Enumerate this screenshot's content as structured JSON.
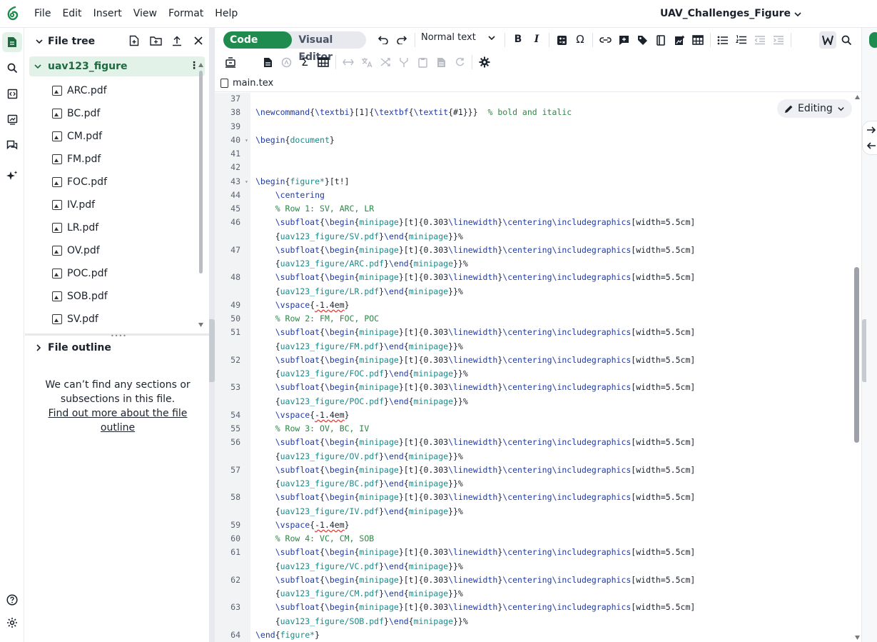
{
  "menu": {
    "items": [
      "File",
      "Edit",
      "Insert",
      "View",
      "Format",
      "Help"
    ],
    "doc_title": "UAV_Challenges_Figure"
  },
  "file_tree": {
    "title": "File tree",
    "folder": "uav123_figure",
    "files": [
      "ARC.pdf",
      "BC.pdf",
      "CM.pdf",
      "FM.pdf",
      "FOC.pdf",
      "IV.pdf",
      "LR.pdf",
      "OV.pdf",
      "POC.pdf",
      "SOB.pdf",
      "SV.pdf"
    ]
  },
  "outline": {
    "title": "File outline",
    "message": "We can’t find any sections or subsections in this file.",
    "link": "Find out more about the file outline"
  },
  "toolbar": {
    "code_editor": "Code Editor",
    "visual_editor": "Visual Editor",
    "text_style": "Normal text",
    "sum_symbol": "Σ",
    "omega_symbol": "Ω"
  },
  "tab": {
    "filename": "main.tex"
  },
  "editor": {
    "mode_badge": "Editing",
    "lines": [
      {
        "n": "37",
        "html": ""
      },
      {
        "n": "38",
        "html": "<span class='kw'>\\newcommand</span>{<span class='kw'>\\textbi</span>}[1]{<span class='kw'>\\textbf</span>{<span class='kw'>\\textit</span>{#1}}}  <span class='cm'>% bold and italic</span>"
      },
      {
        "n": "39",
        "html": ""
      },
      {
        "n": "40",
        "html": "<span class='kw'>\\begin</span>{<span class='ar'>document</span>}",
        "fold": true
      },
      {
        "n": "41",
        "html": ""
      },
      {
        "n": "42",
        "html": ""
      },
      {
        "n": "43",
        "html": "<span class='kw'>\\begin</span>{<span class='ar'>figure*</span>}[t!]",
        "fold": true
      },
      {
        "n": "44",
        "html": "    <span class='kw'>\\centering</span>"
      },
      {
        "n": "45",
        "html": "    <span class='cm'>% Row 1: SV, ARC, LR</span>"
      },
      {
        "n": "46",
        "html": "    <span class='kw'>\\subfloat</span>{<span class='kw'>\\begin</span>{<span class='ar'>minipage</span>}[t]{0.303<span class='kw'>\\linewidth</span>}<span class='kw'>\\centering</span><span class='kw'>\\includegraphics</span>[width=5.5cm]",
        "cont": "    {<span class='ar'>uav123_figure/SV.pdf</span>}<span class='kw'>\\end</span>{<span class='ar'>minipage</span>}}%"
      },
      {
        "n": "47",
        "html": "    <span class='kw'>\\subfloat</span>{<span class='kw'>\\begin</span>{<span class='ar'>minipage</span>}[t]{0.303<span class='kw'>\\linewidth</span>}<span class='kw'>\\centering</span><span class='kw'>\\includegraphics</span>[width=5.5cm]",
        "cont": "    {<span class='ar'>uav123_figure/ARC.pdf</span>}<span class='kw'>\\end</span>{<span class='ar'>minipage</span>}}%"
      },
      {
        "n": "48",
        "html": "    <span class='kw'>\\subfloat</span>{<span class='kw'>\\begin</span>{<span class='ar'>minipage</span>}[t]{0.303<span class='kw'>\\linewidth</span>}<span class='kw'>\\centering</span><span class='kw'>\\includegraphics</span>[width=5.5cm]",
        "cont": "    {<span class='ar'>uav123_figure/LR.pdf</span>}<span class='kw'>\\end</span>{<span class='ar'>minipage</span>}}%"
      },
      {
        "n": "49",
        "html": "    <span class='kw'>\\vspace</span>{<span class='sq'>-1.4em</span>}"
      },
      {
        "n": "50",
        "html": "    <span class='cm'>% Row 2: FM, FOC, POC</span>"
      },
      {
        "n": "51",
        "html": "    <span class='kw'>\\subfloat</span>{<span class='kw'>\\begin</span>{<span class='ar'>minipage</span>}[t]{0.303<span class='kw'>\\linewidth</span>}<span class='kw'>\\centering</span><span class='kw'>\\includegraphics</span>[width=5.5cm]",
        "cont": "    {<span class='ar'>uav123_figure/FM.pdf</span>}<span class='kw'>\\end</span>{<span class='ar'>minipage</span>}}%"
      },
      {
        "n": "52",
        "html": "    <span class='kw'>\\subfloat</span>{<span class='kw'>\\begin</span>{<span class='ar'>minipage</span>}[t]{0.303<span class='kw'>\\linewidth</span>}<span class='kw'>\\centering</span><span class='kw'>\\includegraphics</span>[width=5.5cm]",
        "cont": "    {<span class='ar'>uav123_figure/FOC.pdf</span>}<span class='kw'>\\end</span>{<span class='ar'>minipage</span>}}%"
      },
      {
        "n": "53",
        "html": "    <span class='kw'>\\subfloat</span>{<span class='kw'>\\begin</span>{<span class='ar'>minipage</span>}[t]{0.303<span class='kw'>\\linewidth</span>}<span class='kw'>\\centering</span><span class='kw'>\\includegraphics</span>[width=5.5cm]",
        "cont": "    {<span class='ar'>uav123_figure/POC.pdf</span>}<span class='kw'>\\end</span>{<span class='ar'>minipage</span>}}%"
      },
      {
        "n": "54",
        "html": "    <span class='kw'>\\vspace</span>{<span class='sq'>-1.4em</span>}"
      },
      {
        "n": "55",
        "html": "    <span class='cm'>% Row 3: OV, BC, IV</span>"
      },
      {
        "n": "56",
        "html": "    <span class='kw'>\\subfloat</span>{<span class='kw'>\\begin</span>{<span class='ar'>minipage</span>}[t]{0.303<span class='kw'>\\linewidth</span>}<span class='kw'>\\centering</span><span class='kw'>\\includegraphics</span>[width=5.5cm]",
        "cont": "    {<span class='ar'>uav123_figure/OV.pdf</span>}<span class='kw'>\\end</span>{<span class='ar'>minipage</span>}}%"
      },
      {
        "n": "57",
        "html": "    <span class='kw'>\\subfloat</span>{<span class='kw'>\\begin</span>{<span class='ar'>minipage</span>}[t]{0.303<span class='kw'>\\linewidth</span>}<span class='kw'>\\centering</span><span class='kw'>\\includegraphics</span>[width=5.5cm]",
        "cont": "    {<span class='ar'>uav123_figure/BC.pdf</span>}<span class='kw'>\\end</span>{<span class='ar'>minipage</span>}}%"
      },
      {
        "n": "58",
        "html": "    <span class='kw'>\\subfloat</span>{<span class='kw'>\\begin</span>{<span class='ar'>minipage</span>}[t]{0.303<span class='kw'>\\linewidth</span>}<span class='kw'>\\centering</span><span class='kw'>\\includegraphics</span>[width=5.5cm]",
        "cont": "    {<span class='ar'>uav123_figure/IV.pdf</span>}<span class='kw'>\\end</span>{<span class='ar'>minipage</span>}}%"
      },
      {
        "n": "59",
        "html": "    <span class='kw'>\\vspace</span>{<span class='sq'>-1.4em</span>}"
      },
      {
        "n": "60",
        "html": "    <span class='cm'>% Row 4: VC, CM, SOB</span>"
      },
      {
        "n": "61",
        "html": "    <span class='kw'>\\subfloat</span>{<span class='kw'>\\begin</span>{<span class='ar'>minipage</span>}[t]{0.303<span class='kw'>\\linewidth</span>}<span class='kw'>\\centering</span><span class='kw'>\\includegraphics</span>[width=5.5cm]",
        "cont": "    {<span class='ar'>uav123_figure/VC.pdf</span>}<span class='kw'>\\end</span>{<span class='ar'>minipage</span>}}%"
      },
      {
        "n": "62",
        "html": "    <span class='kw'>\\subfloat</span>{<span class='kw'>\\begin</span>{<span class='ar'>minipage</span>}[t]{0.303<span class='kw'>\\linewidth</span>}<span class='kw'>\\centering</span><span class='kw'>\\includegraphics</span>[width=5.5cm]",
        "cont": "    {<span class='ar'>uav123_figure/CM.pdf</span>}<span class='kw'>\\end</span>{<span class='ar'>minipage</span>}}%"
      },
      {
        "n": "63",
        "html": "    <span class='kw'>\\subfloat</span>{<span class='kw'>\\begin</span>{<span class='ar'>minipage</span>}[t]{0.303<span class='kw'>\\linewidth</span>}<span class='kw'>\\centering</span><span class='kw'>\\includegraphics</span>[width=5.5cm]",
        "cont": "    {<span class='ar'>uav123_figure/SOB.pdf</span>}<span class='kw'>\\end</span>{<span class='ar'>minipage</span>}}%"
      },
      {
        "n": "64",
        "html": "<span class='kw'>\\end</span>{<span class='ar'>figure*</span>}"
      }
    ]
  }
}
